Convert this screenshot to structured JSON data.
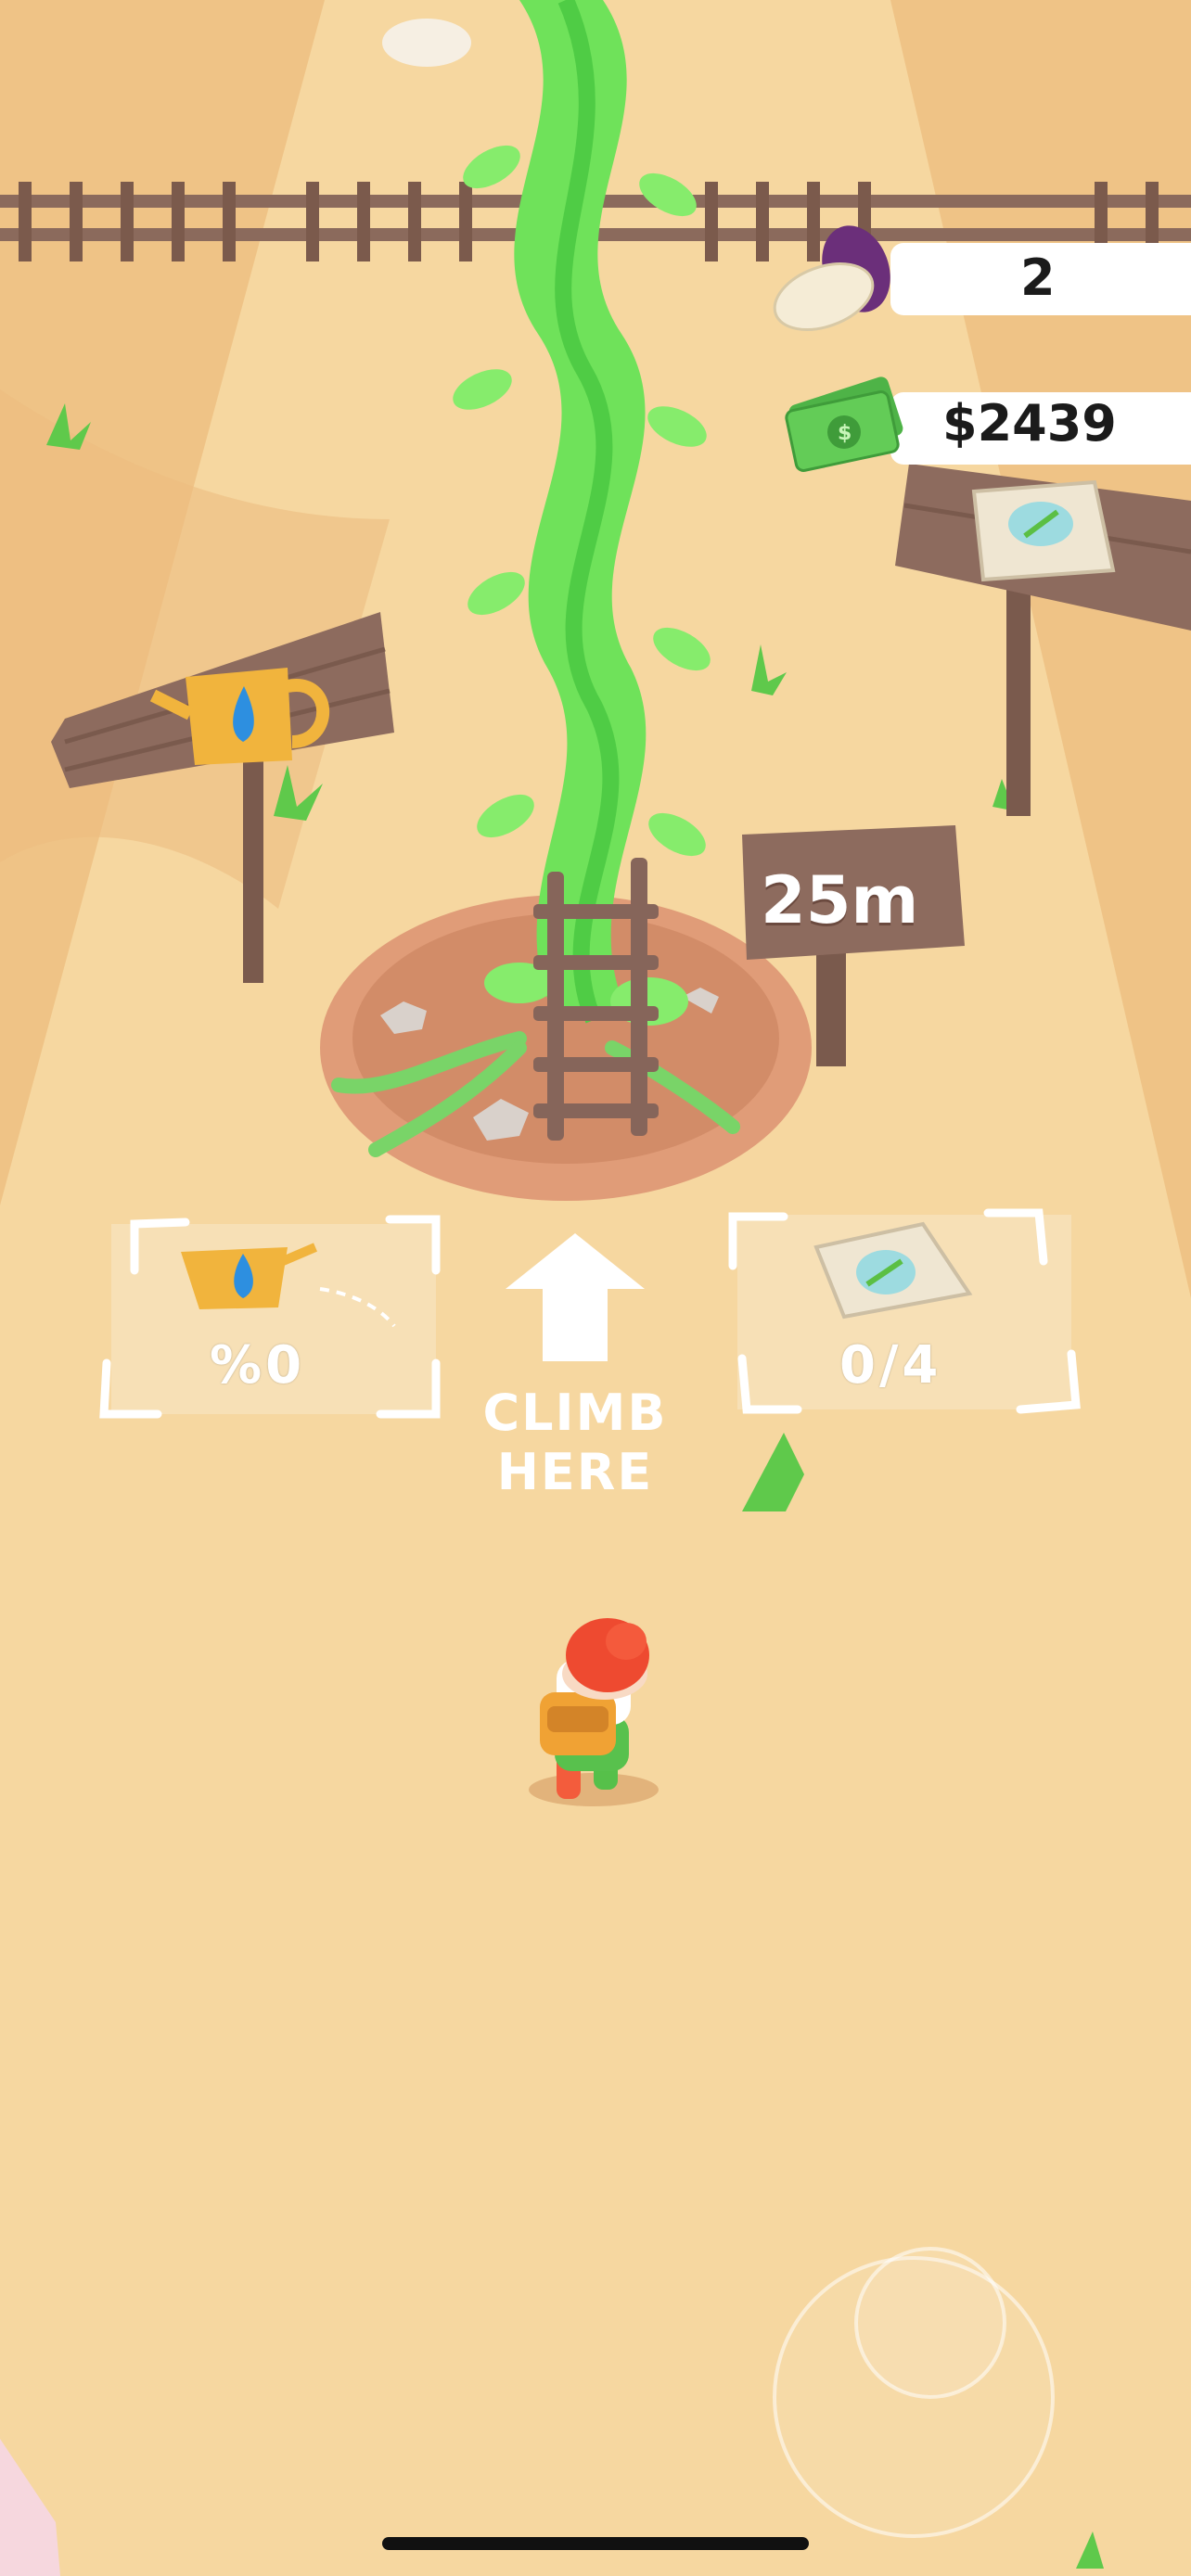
{
  "hud": {
    "beans_count": "2",
    "cash_amount": "$2439",
    "bean_icon": "bean-icon",
    "cash_icon": "cash-icon"
  },
  "pads": {
    "water_progress": "%0",
    "seed_progress": "0/4",
    "water_icon": "watering-can-icon",
    "seed_icon": "seed-bag-icon"
  },
  "beanstalk_sign": {
    "height_label": "25m"
  },
  "climb": {
    "line1": "CLIMB",
    "line2": "HERE"
  },
  "colors": {
    "sand": "#f1c98b",
    "path": "#f6d9a4",
    "beanstalk": "#6fe25a",
    "wood": "#8d6b5e",
    "cash_green": "#53c24a"
  }
}
